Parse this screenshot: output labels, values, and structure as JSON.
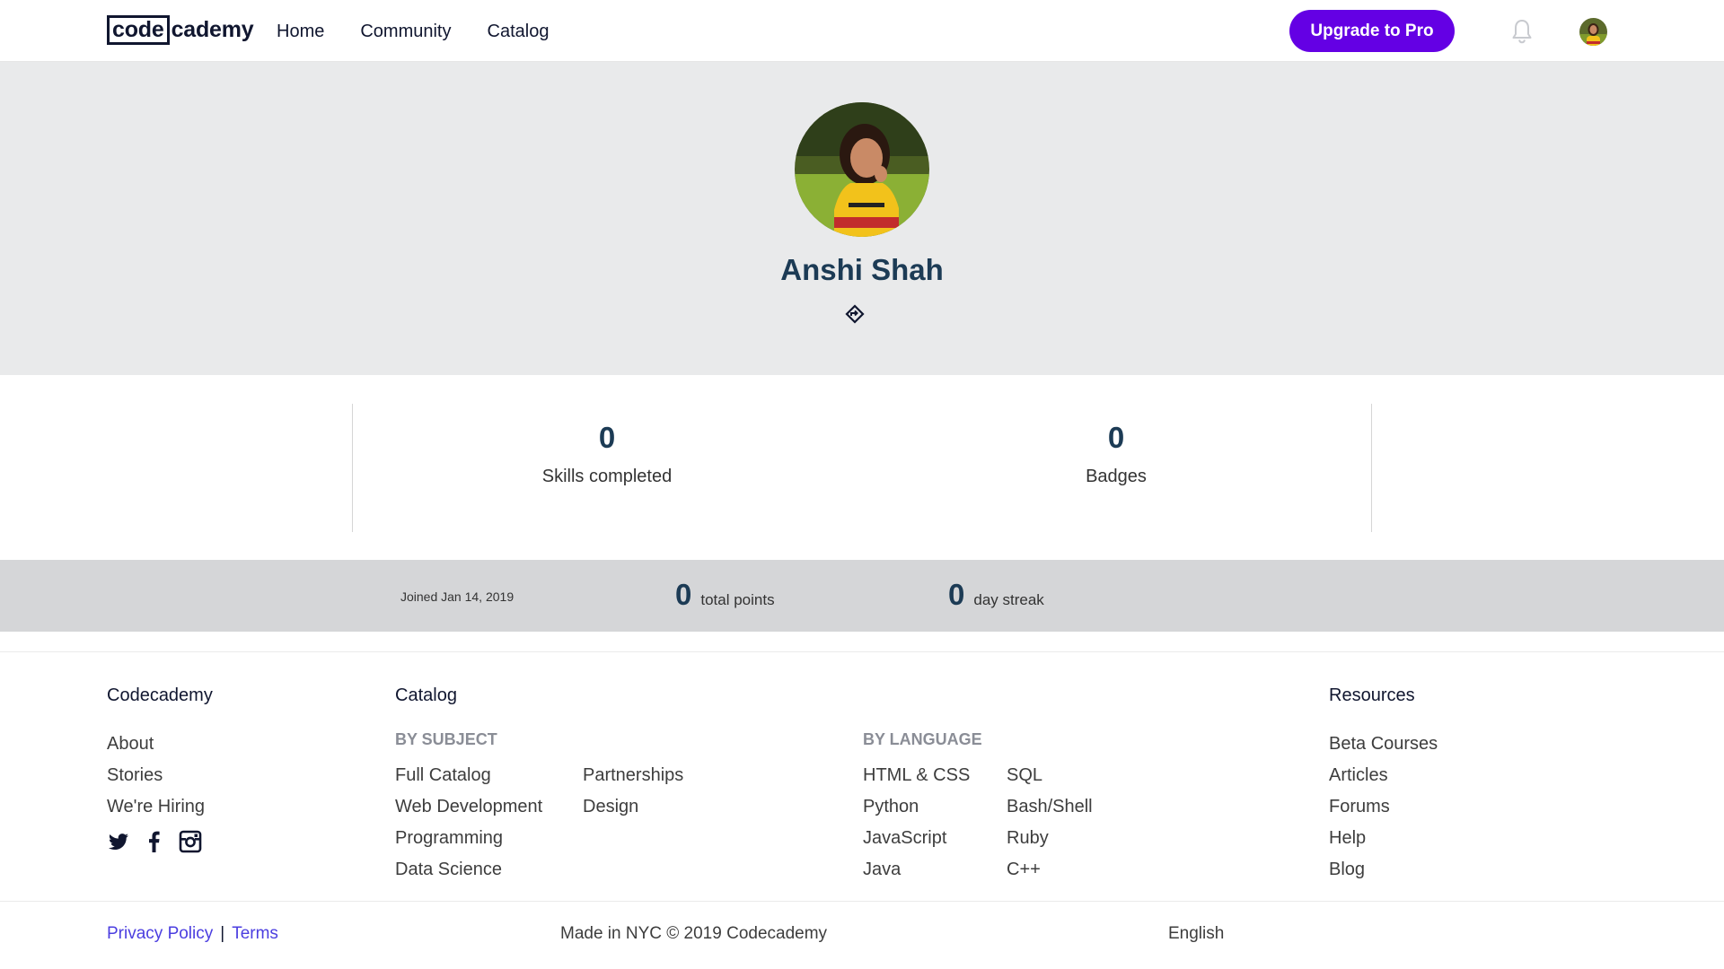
{
  "header": {
    "logo_box": "code",
    "logo_rest": "cademy",
    "nav": [
      "Home",
      "Community",
      "Catalog"
    ],
    "upgrade_label": "Upgrade to Pro"
  },
  "profile": {
    "name": "Anshi Shah"
  },
  "stats": {
    "skills_value": "0",
    "skills_label": "Skills completed",
    "badges_value": "0",
    "badges_label": "Badges"
  },
  "summary": {
    "joined": "Joined Jan 14, 2019",
    "points_value": "0",
    "points_label": "total points",
    "streak_value": "0",
    "streak_label": "day streak"
  },
  "footer": {
    "codecademy": {
      "heading": "Codecademy",
      "links": [
        "About",
        "Stories",
        "We're Hiring"
      ]
    },
    "catalog": {
      "heading": "Catalog",
      "by_subject_label": "BY SUBJECT",
      "subjects_col1": [
        "Full Catalog",
        "Web Development",
        "Programming",
        "Data Science"
      ],
      "subjects_col2": [
        "Partnerships",
        "Design"
      ],
      "by_language_label": "BY LANGUAGE",
      "languages_col1": [
        "HTML & CSS",
        "Python",
        "JavaScript",
        "Java"
      ],
      "languages_col2": [
        "SQL",
        "Bash/Shell",
        "Ruby",
        "C++"
      ]
    },
    "resources": {
      "heading": "Resources",
      "links": [
        "Beta Courses",
        "Articles",
        "Forums",
        "Help",
        "Blog"
      ]
    },
    "privacy": "Privacy Policy",
    "separator": "|",
    "terms": "Terms",
    "copyright": "Made in NYC © 2019 Codecademy",
    "language": "English"
  },
  "icons": {
    "bell": "bell-icon",
    "share": "share-icon",
    "twitter": "twitter-icon",
    "facebook": "facebook-icon",
    "instagram": "instagram-icon"
  },
  "colors": {
    "brand_purple": "#6400e4",
    "navy": "#1c3b55",
    "hero_bg": "#e9eaeb",
    "summary_bg": "#d5d6d8",
    "link_purple": "#4b3ee0"
  }
}
